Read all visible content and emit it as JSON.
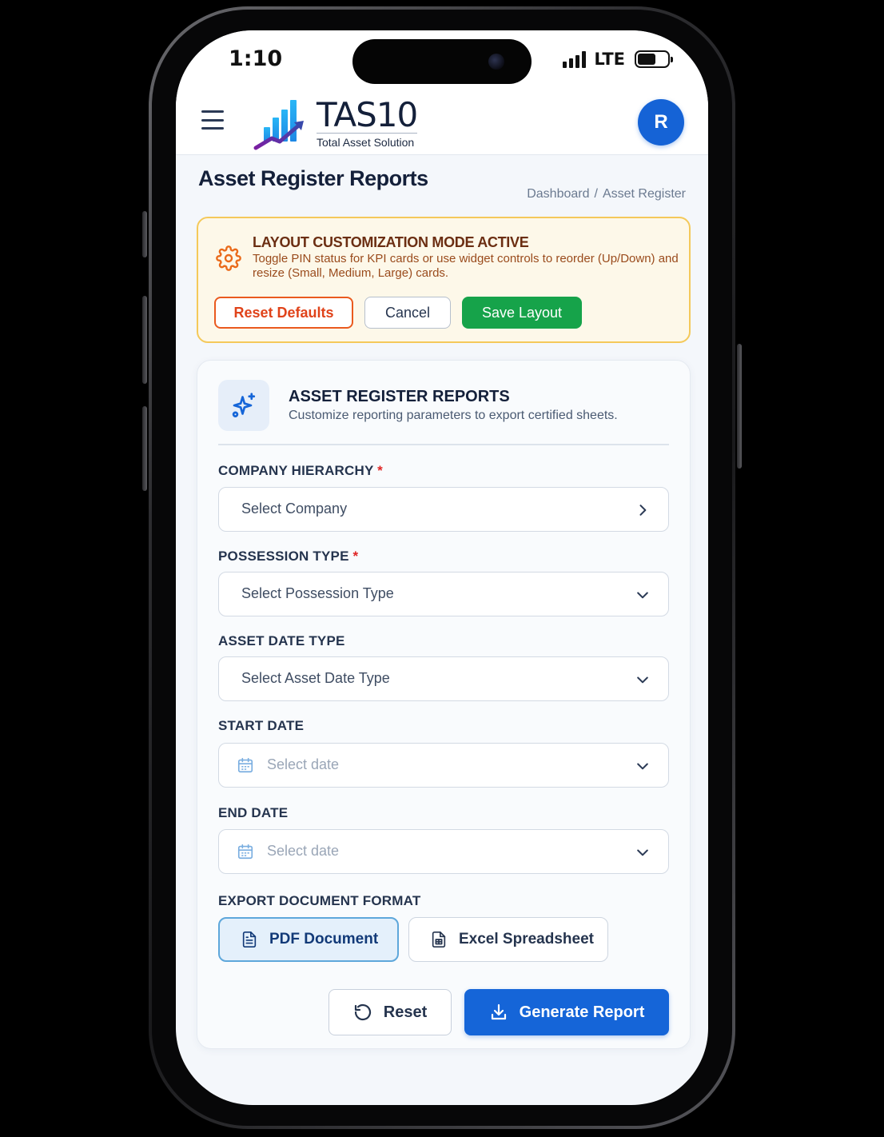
{
  "status_bar": {
    "time": "1:10",
    "network": "LTE"
  },
  "header": {
    "logo_title": "TAS10",
    "logo_subtitle": "Total Asset Solution",
    "avatar_initial": "R"
  },
  "page": {
    "title": "Asset Register Reports",
    "breadcrumb": [
      "Dashboard",
      "/",
      "Asset Register"
    ]
  },
  "banner": {
    "title": "LAYOUT CUSTOMIZATION MODE ACTIVE",
    "text": "Toggle PIN status for KPI cards or use widget controls to reorder (Up/Down) and resize (Small, Medium, Large) cards.",
    "reset_defaults_label": "Reset Defaults",
    "cancel_label": "Cancel",
    "save_layout_label": "Save Layout"
  },
  "report_card": {
    "title": "ASSET REGISTER REPORTS",
    "subtitle": "Customize reporting parameters to export certified sheets.",
    "fields": {
      "company": {
        "label": "COMPANY HIERARCHY",
        "required_mark": "*",
        "value": "Select Company"
      },
      "possession_type": {
        "label": "POSSESSION TYPE",
        "required_mark": "*",
        "value": "Select Possession Type"
      },
      "asset_date_type": {
        "label": "ASSET DATE TYPE",
        "value": "Select Asset Date Type"
      },
      "start_date": {
        "label": "START DATE",
        "placeholder": "Select date"
      },
      "end_date": {
        "label": "END DATE",
        "placeholder": "Select date"
      }
    },
    "export_format": {
      "label": "EXPORT DOCUMENT FORMAT",
      "options": [
        "PDF Document",
        "Excel Spreadsheet"
      ],
      "selected": "PDF Document"
    },
    "actions": {
      "reset_label": "Reset",
      "generate_label": "Generate Report"
    }
  },
  "colors": {
    "primary": "#1565d8",
    "success": "#16a34a",
    "warning_border": "#f4c95a",
    "danger": "#e0431a",
    "heading": "#14203a"
  }
}
